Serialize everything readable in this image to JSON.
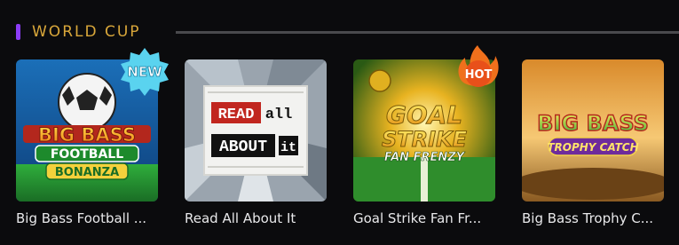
{
  "section": {
    "title": "WORLD CUP"
  },
  "games": [
    {
      "title": "Big Bass Football ...",
      "logo": [
        "BIG BASS",
        "FOOTBALL",
        "BONANZA"
      ],
      "badge": "NEW"
    },
    {
      "title": "Read All About It",
      "logo": [
        "READ",
        "all",
        "ABOUT",
        "it"
      ],
      "badge": ""
    },
    {
      "title": "Goal Strike Fan Fr...",
      "logo": [
        "GOAL",
        "STRIKE",
        "FAN FRENZY"
      ],
      "badge": "HOT"
    },
    {
      "title": "Big Bass Trophy C...",
      "logo": [
        "BIG BASS",
        "TROPHY CATCH"
      ],
      "badge": ""
    }
  ],
  "colors": {
    "accent": "#8b3cf7",
    "section_title": "#d9a73a",
    "background": "#0b0b0d",
    "new_badge": "#5ad3ef",
    "hot_badge": "#f0701c"
  }
}
